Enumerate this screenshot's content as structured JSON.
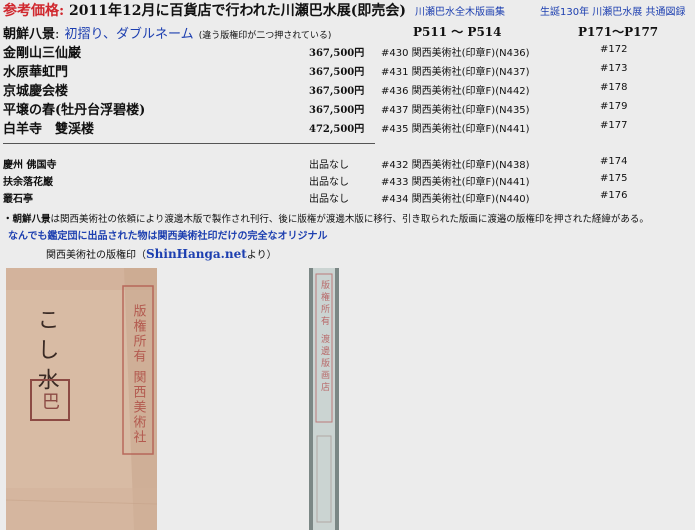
{
  "header": {
    "label": "参考価格",
    "colon": ":",
    "title": "2011年12月に百貨店で行われた川瀬巴水展(即売会)",
    "link1": "川瀬巴水全木版画集",
    "link2": "生誕130年 川瀬巴水展 共通図録"
  },
  "subheader": {
    "series": "朝鮮八景",
    "colon": ":",
    "type": "初摺り、ダブルネーム",
    "note": "(違う版権印が二つ押されている)",
    "col_p1": "P511 〜 P514",
    "col_p2": "P171〜P177"
  },
  "prints": [
    {
      "name": "金剛山三仙巌",
      "price": "367,500円",
      "catalog": "#430 関西美術社(印章F)(N436)",
      "page": "#172"
    },
    {
      "name": "水原華虹門",
      "price": "367,500円",
      "catalog": "#431 関西美術社(印章F)(N437)",
      "page": "#173"
    },
    {
      "name": "京城慶会楼",
      "price": "367,500円",
      "catalog": "#436 関西美術社(印章F)(N442)",
      "page": "#178"
    },
    {
      "name": "平壌の春(牡丹台浮碧楼)",
      "price": "367,500円",
      "catalog": "#437 関西美術社(印章F)(N435)",
      "page": "#179"
    },
    {
      "name": "白羊寺　雙渓楼",
      "price": "472,500円",
      "catalog": "#435 関西美術社(印章F)(N441)",
      "page": "#177"
    }
  ],
  "unlisted": [
    {
      "name": "慶州 佛国寺",
      "price": "出品なし",
      "catalog": "#432 関西美術社(印章F)(N438)",
      "page": "#174"
    },
    {
      "name": "扶余落花巌",
      "price": "出品なし",
      "catalog": "#433 関西美術社(印章F)(N441)",
      "page": "#175"
    },
    {
      "name": "叢石亭",
      "price": "出品なし",
      "catalog": "#434 関西美術社(印章F)(N440)",
      "page": "#176"
    }
  ],
  "footnote": {
    "prefix": "・朝鮮八景",
    "text": "は関西美術社の依頼により渡邊木版で製作され刊行、後に版権が渡邊木版に移行、引き取られた版画に渡邉の版権印を押された経緯がある。"
  },
  "notice": "なんでも鑑定団に出品された物は関西美術社印だけの完全なオリジナル",
  "seal_caption": {
    "before": "関西美術社の版権印（",
    "link": "ShinHanga.net",
    "after": "より）"
  },
  "stamp_texts": {
    "left_brush": "こし水",
    "left_seal": "巴",
    "left_stamp": "版権所有 関西美術社",
    "right_stamp": "版権所有 渡邊版画店"
  },
  "colors": {
    "accent_red": "#d0282e",
    "link_blue": "#1d3fb0",
    "background": "#ececec",
    "stamp_red": "#b35a4f"
  }
}
